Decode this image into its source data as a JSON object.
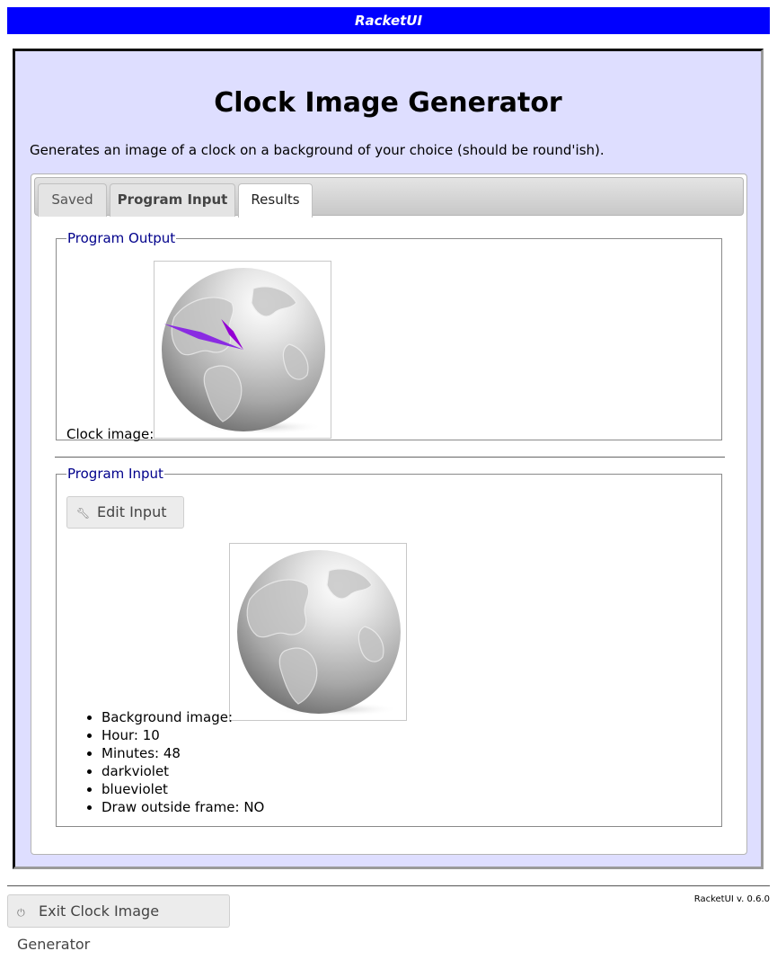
{
  "topbar": {
    "title": "RacketUI"
  },
  "app": {
    "title": "Clock Image Generator",
    "description": "Generates an image of a clock on a background of your choice (should be round'ish)."
  },
  "tabs": [
    {
      "label": "Saved"
    },
    {
      "label": "Program Input"
    },
    {
      "label": "Results"
    }
  ],
  "active_tab": "Results",
  "output": {
    "legend": "Program Output",
    "clock_label": "Clock image:"
  },
  "input": {
    "legend": "Program Input",
    "edit_button": "Edit Input",
    "items": [
      "Background image:",
      "Hour: 10",
      "Minutes: 48",
      "darkviolet",
      "blueviolet",
      "Draw outside frame: NO"
    ]
  },
  "clock": {
    "hour": 10,
    "minute": 48,
    "hour_hand_color": "#9400d3",
    "minute_hand_color": "#8a2be2"
  },
  "footer": {
    "exit_button": "Exit Clock Image Generator",
    "version": "RacketUI v. 0.6.0"
  },
  "colors": {
    "topbar": "#0000ff",
    "panel_bg": "#dedeff",
    "legend": "#00008b"
  },
  "icons": {
    "edit": "wrench-icon",
    "exit": "power-icon"
  }
}
